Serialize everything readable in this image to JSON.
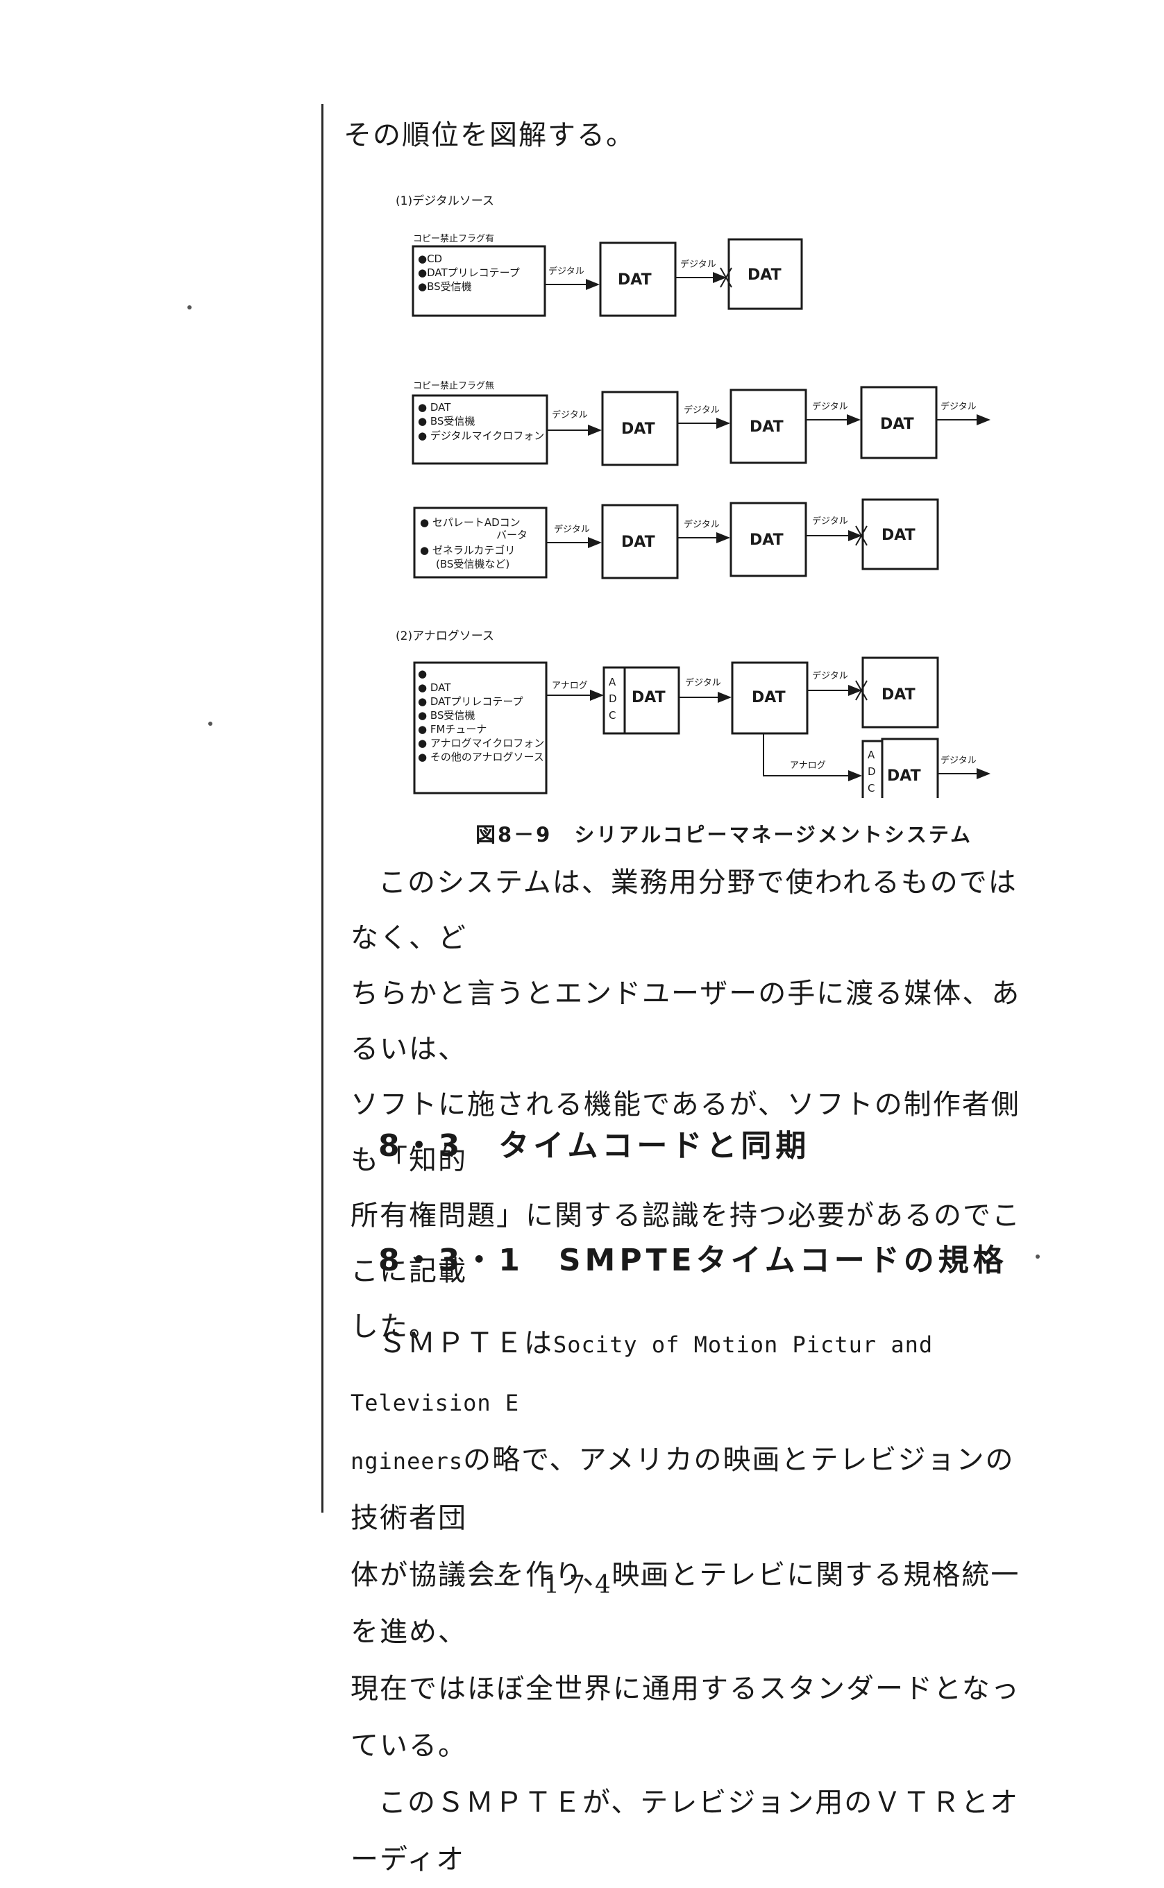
{
  "intro_text": "その順位を図解する。",
  "figure": {
    "section1_label": "(1)デジタルソース",
    "section2_label": "(2)アナログソース",
    "row1": {
      "flag_label": "コピー禁止フラグ有",
      "sources": [
        "●CD",
        "●DATプリレコテープ",
        "●BS受信機"
      ],
      "link1": "デジタル",
      "link2": "デジタル",
      "boxes": [
        "DAT",
        "DAT"
      ]
    },
    "row2": {
      "flag_label": "コピー禁止フラグ無",
      "sources": [
        "● DAT",
        "● BS受信機",
        "● デジタルマイクロフォン"
      ],
      "links": [
        "デジタル",
        "デジタル",
        "デジタル",
        "デジタル"
      ],
      "boxes": [
        "DAT",
        "DAT",
        "DAT"
      ]
    },
    "row3": {
      "sources": [
        "● セパレートADコン",
        "バータ",
        "● ゼネラルカテゴリ",
        "(BS受信機など)"
      ],
      "links": [
        "デジタル",
        "デジタル",
        "デジタル"
      ],
      "boxes": [
        "DAT",
        "DAT",
        "DAT"
      ]
    },
    "row4": {
      "sources": [
        "●",
        "● DAT",
        "● DATプリレコテープ",
        "● BS受信機",
        "● FMチューナ",
        "● アナログマイクロフォン",
        "● その他のアナログソース"
      ],
      "links": [
        "アナログ",
        "デジタル",
        "デジタル",
        "アナログ",
        "デジタル"
      ],
      "adc_letters": [
        "A",
        "D",
        "C"
      ],
      "boxes": [
        "DAT",
        "DAT",
        "DAT",
        "DAT"
      ]
    }
  },
  "caption": "図8－9　シリアルコピーマネージメントシステム",
  "para1": [
    "このシステムは、業務用分野で使われるものではなく、ど",
    "ちらかと言うとエンドユーザーの手に渡る媒体、あるいは、",
    "ソフトに施される機能であるが、ソフトの制作者側も「知的",
    "所有権問題」に関する認識を持つ必要があるのでここに記載",
    "した。"
  ],
  "heading1": "8・3　タイムコードと同期",
  "heading2": "8・3・1　SMPTEタイムコードの規格",
  "para2": {
    "line1_a": "ＳＭＰＴＥは",
    "line1_b": "Socity of Motion Pictur and Television E",
    "line2_a": "ngineers",
    "line2_b": "の略で、アメリカの映画とテレビジョンの技術者団",
    "line3": "体が協議会を作り、映画とテレビに関する規格統一を進め、",
    "line4": "現在ではほぼ全世界に通用するスタンダードとなっている。",
    "line5": "このＳＭＰＴＥが、テレビジョン用のＶＴＲとオーディオ"
  },
  "page_number": "－ 174 －"
}
